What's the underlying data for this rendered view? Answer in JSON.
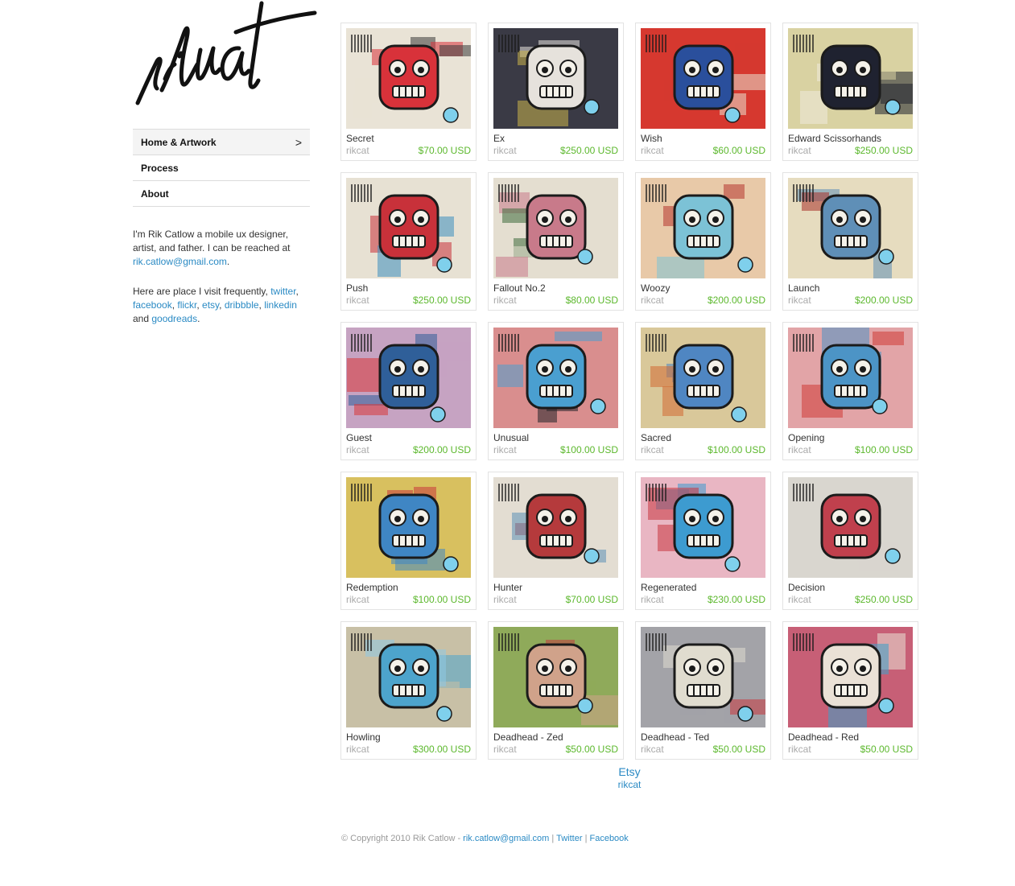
{
  "logo": {
    "text": "rikcat"
  },
  "nav": [
    {
      "label": "Home & Artwork",
      "active": true,
      "chevron": ">"
    },
    {
      "label": "Process",
      "active": false
    },
    {
      "label": "About",
      "active": false
    }
  ],
  "bio": {
    "p1_text": "I'm Rik Catlow a mobile ux designer, artist, and father. I can be reached at ",
    "email": "rik.catlow@gmail.com",
    "p1_end": ".",
    "p2_text": "Here are place I visit frequently, ",
    "links": [
      "twitter",
      "facebook",
      "flickr",
      "etsy",
      "dribbble",
      "linkedin"
    ],
    "and": " and ",
    "last_link": "goodreads",
    "p2_end": "."
  },
  "products": [
    {
      "title": "Secret",
      "seller": "rikcat",
      "price": "$70.00 USD",
      "colors": [
        "#e9e3d6",
        "#d8323a",
        "#3a3a3a"
      ]
    },
    {
      "title": "Ex",
      "seller": "rikcat",
      "price": "$250.00 USD",
      "colors": [
        "#3a3a45",
        "#e6e2dc",
        "#c9b24a"
      ]
    },
    {
      "title": "Wish",
      "seller": "rikcat",
      "price": "$60.00 USD",
      "colors": [
        "#d6382f",
        "#2a4f9c",
        "#e9e2d0"
      ]
    },
    {
      "title": "Edward Scissorhands",
      "seller": "rikcat",
      "price": "$250.00 USD",
      "colors": [
        "#d9d2a2",
        "#1f2230",
        "#eee9dc"
      ]
    },
    {
      "title": "Push",
      "seller": "rikcat",
      "price": "$250.00 USD",
      "colors": [
        "#e7e1d3",
        "#c8313a",
        "#3c8fbf"
      ]
    },
    {
      "title": "Fallout No.2",
      "seller": "rikcat",
      "price": "$80.00 USD",
      "colors": [
        "#e4ded0",
        "#c87a8a",
        "#3e6b3c"
      ]
    },
    {
      "title": "Woozy",
      "seller": "rikcat",
      "price": "$200.00 USD",
      "colors": [
        "#e8c9a8",
        "#7cc2d6",
        "#b5342e"
      ]
    },
    {
      "title": "Launch",
      "seller": "rikcat",
      "price": "$200.00 USD",
      "colors": [
        "#e6dcbf",
        "#5f8fb7",
        "#a8322a"
      ]
    },
    {
      "title": "Guest",
      "seller": "rikcat",
      "price": "$200.00 USD",
      "colors": [
        "#c6a3c2",
        "#2f5f99",
        "#d8383a"
      ]
    },
    {
      "title": "Unusual",
      "seller": "rikcat",
      "price": "$100.00 USD",
      "colors": [
        "#d98e8e",
        "#4a9fd0",
        "#222228"
      ]
    },
    {
      "title": "Sacred",
      "seller": "rikcat",
      "price": "$100.00 USD",
      "colors": [
        "#d9c89a",
        "#4f86c2",
        "#d16a33"
      ]
    },
    {
      "title": "Opening",
      "seller": "rikcat",
      "price": "$100.00 USD",
      "colors": [
        "#e2a4a7",
        "#4c94c6",
        "#cf3a36"
      ]
    },
    {
      "title": "Redemption",
      "seller": "rikcat",
      "price": "$100.00 USD",
      "colors": [
        "#d8c05f",
        "#3f86c4",
        "#c9363a"
      ]
    },
    {
      "title": "Hunter",
      "seller": "rikcat",
      "price": "$70.00 USD",
      "colors": [
        "#e3ddd2",
        "#b53a3c",
        "#5c8fb6"
      ]
    },
    {
      "title": "Regenerated",
      "seller": "rikcat",
      "price": "$230.00 USD",
      "colors": [
        "#e9b6c3",
        "#3d9bd0",
        "#c9363f"
      ]
    },
    {
      "title": "Decision",
      "seller": "rikcat",
      "price": "$250.00 USD",
      "colors": [
        "#d9d6cf",
        "#c0404d",
        "#6f8f7a"
      ]
    },
    {
      "title": "Howling",
      "seller": "rikcat",
      "price": "$300.00 USD",
      "colors": [
        "#c8c0a6",
        "#4da4cc",
        "#8ec9e6"
      ]
    },
    {
      "title": "Deadhead - Zed",
      "seller": "rikcat",
      "price": "$50.00 USD",
      "colors": [
        "#8faa5a",
        "#d0a28a",
        "#c33a3f"
      ]
    },
    {
      "title": "Deadhead - Ted",
      "seller": "rikcat",
      "price": "$50.00 USD",
      "colors": [
        "#a3a3a8",
        "#e0dccf",
        "#c8393e"
      ]
    },
    {
      "title": "Deadhead - Red",
      "seller": "rikcat",
      "price": "$50.00 USD",
      "colors": [
        "#c75f76",
        "#eae1d6",
        "#3aa0c8"
      ]
    }
  ],
  "etsy": {
    "brand": "Etsy",
    "user": "rikcat"
  },
  "footer": {
    "copyright": "© Copyright 2010 Rik Catlow - ",
    "email": "rik.catlow@gmail.com",
    "twitter": "Twitter",
    "facebook": "Facebook",
    "sep": "|"
  }
}
